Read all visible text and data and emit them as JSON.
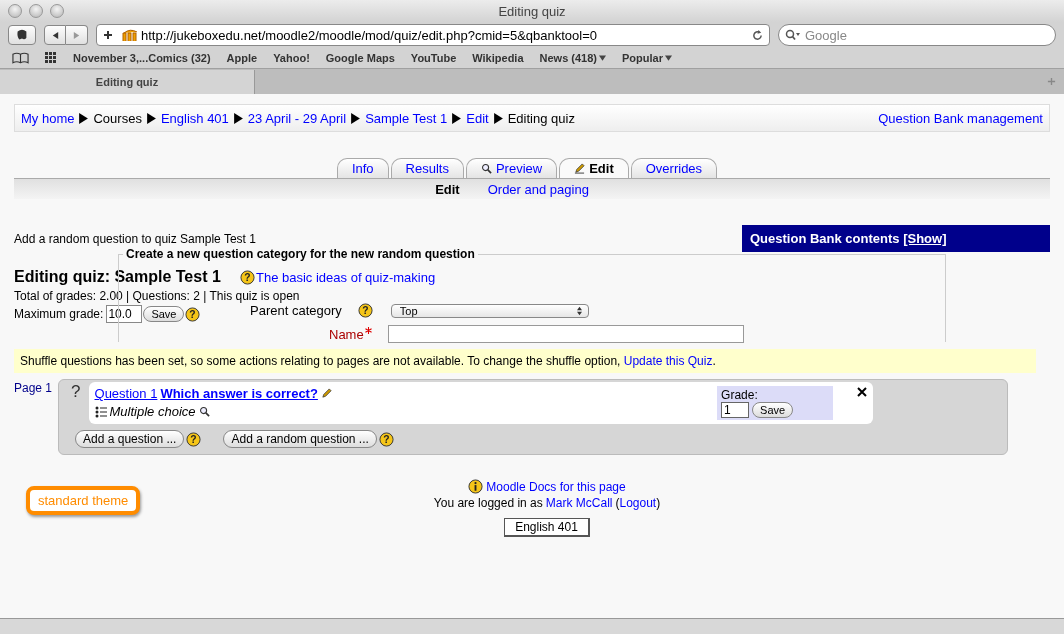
{
  "window": {
    "title": "Editing quiz"
  },
  "toolbar": {
    "url": "http://jukeboxedu.net/moodle2/moodle/mod/quiz/edit.php?cmid=5&qbanktool=0",
    "search_placeholder": "Google"
  },
  "bookmarks": [
    {
      "label": "November 3,...Comics (32)",
      "menu": false
    },
    {
      "label": "Apple",
      "menu": false
    },
    {
      "label": "Yahoo!",
      "menu": false
    },
    {
      "label": "Google Maps",
      "menu": false
    },
    {
      "label": "YouTube",
      "menu": false
    },
    {
      "label": "Wikipedia",
      "menu": false
    },
    {
      "label": "News (418)",
      "menu": true
    },
    {
      "label": "Popular",
      "menu": true
    }
  ],
  "browser_tab": {
    "label": "Editing quiz"
  },
  "breadcrumb": [
    {
      "label": "My home",
      "link": true
    },
    {
      "label": "Courses",
      "link": false
    },
    {
      "label": "English 401",
      "link": true
    },
    {
      "label": "23 April - 29 April",
      "link": true
    },
    {
      "label": "Sample Test 1",
      "link": true
    },
    {
      "label": "Edit",
      "link": true
    },
    {
      "label": "Editing quiz",
      "link": false
    }
  ],
  "question_bank_link": "Question Bank management",
  "tabs": [
    {
      "label": "Info",
      "selected": false,
      "kind": "text"
    },
    {
      "label": "Results",
      "selected": false,
      "kind": "text"
    },
    {
      "label": "Preview",
      "selected": false,
      "kind": "preview"
    },
    {
      "label": "Edit",
      "selected": true,
      "kind": "edit"
    },
    {
      "label": "Overrides",
      "selected": false,
      "kind": "text"
    }
  ],
  "subtabs": [
    {
      "label": "Edit",
      "selected": true
    },
    {
      "label": "Order and paging",
      "selected": false
    }
  ],
  "intro": "Add a random question to quiz Sample Test 1",
  "question_bank_panel": {
    "title": "Question Bank contents",
    "show_link": "[Show]"
  },
  "category_form": {
    "legend": "Create a new question category for the new random question",
    "parent_label": "Parent category",
    "parent_value": "Top",
    "name_label": "Name",
    "name_required": true
  },
  "quiz": {
    "heading": "Editing quiz: Sample Test 1",
    "help_link": "The basic ideas of quiz-making",
    "totals": "Total of grades: 2.00 | Questions: 2 | This quiz is open",
    "max_grade_label": "Maximum grade:",
    "max_grade_value": "10.0",
    "save": "Save"
  },
  "notice": {
    "text": "Shuffle questions has been set, so some actions relating to pages are not available. To change the shuffle option,",
    "link": "Update this Quiz",
    "end": "."
  },
  "page": {
    "label": "Page 1",
    "questions": [
      {
        "marker": "?",
        "number": "Question 1",
        "title": "Which answer is correct?",
        "type": "Multiple choice",
        "grade_label": "Grade:",
        "grade": "1",
        "save": "Save"
      }
    ],
    "buttons": [
      "Add a question ...",
      "Add a random question ..."
    ]
  },
  "footer": {
    "docs_link": "Moodle Docs for this page",
    "logged_in": "You are logged in as",
    "user": "Mark McCall",
    "paren_open": "(",
    "logout": "Logout",
    "paren_close": ")",
    "course_button": "English 401"
  },
  "theme_badge": "standard theme"
}
